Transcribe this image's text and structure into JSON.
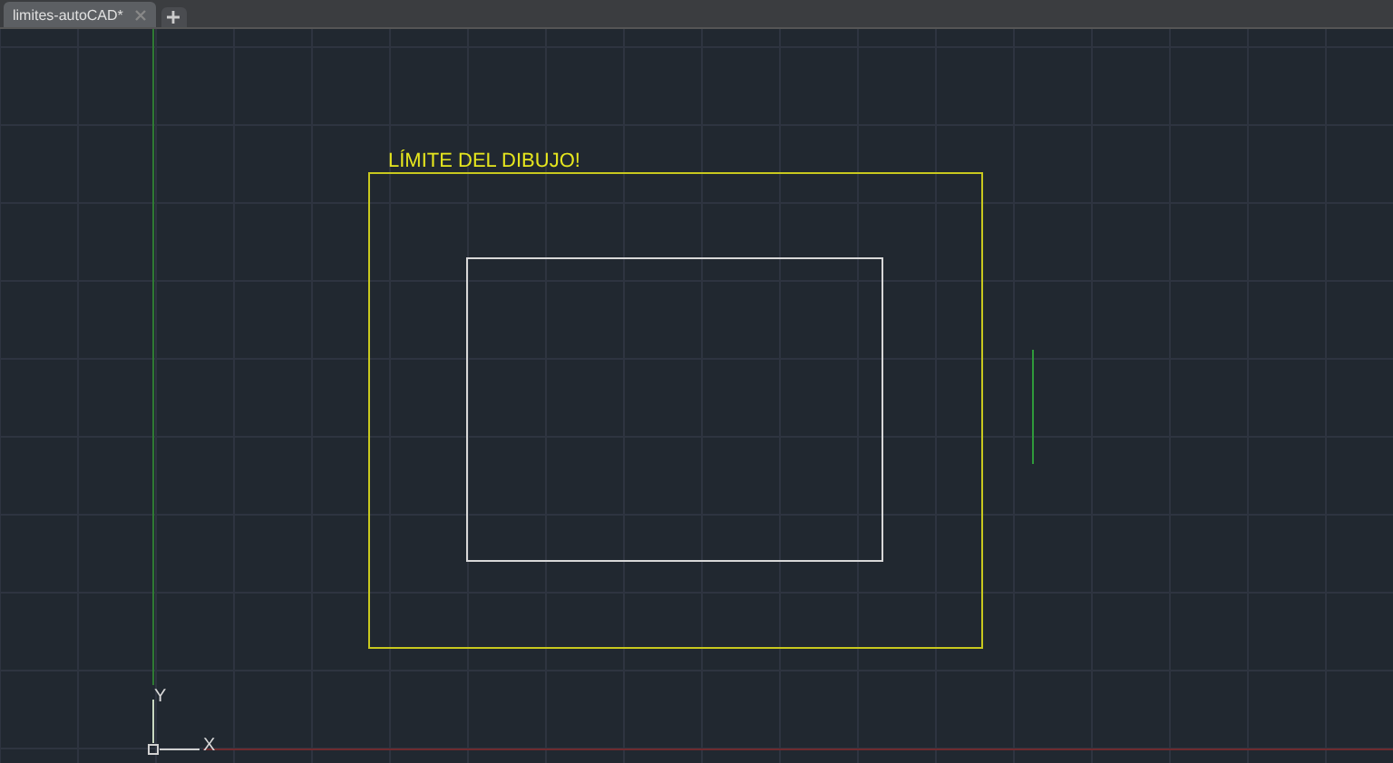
{
  "tabs": [
    {
      "label": "limites-autoCAD*",
      "selected": true
    }
  ],
  "drawing": {
    "label": "LÍMITE DEL DIBUJO!",
    "ucs": {
      "x_label": "X",
      "y_label": "Y"
    }
  }
}
